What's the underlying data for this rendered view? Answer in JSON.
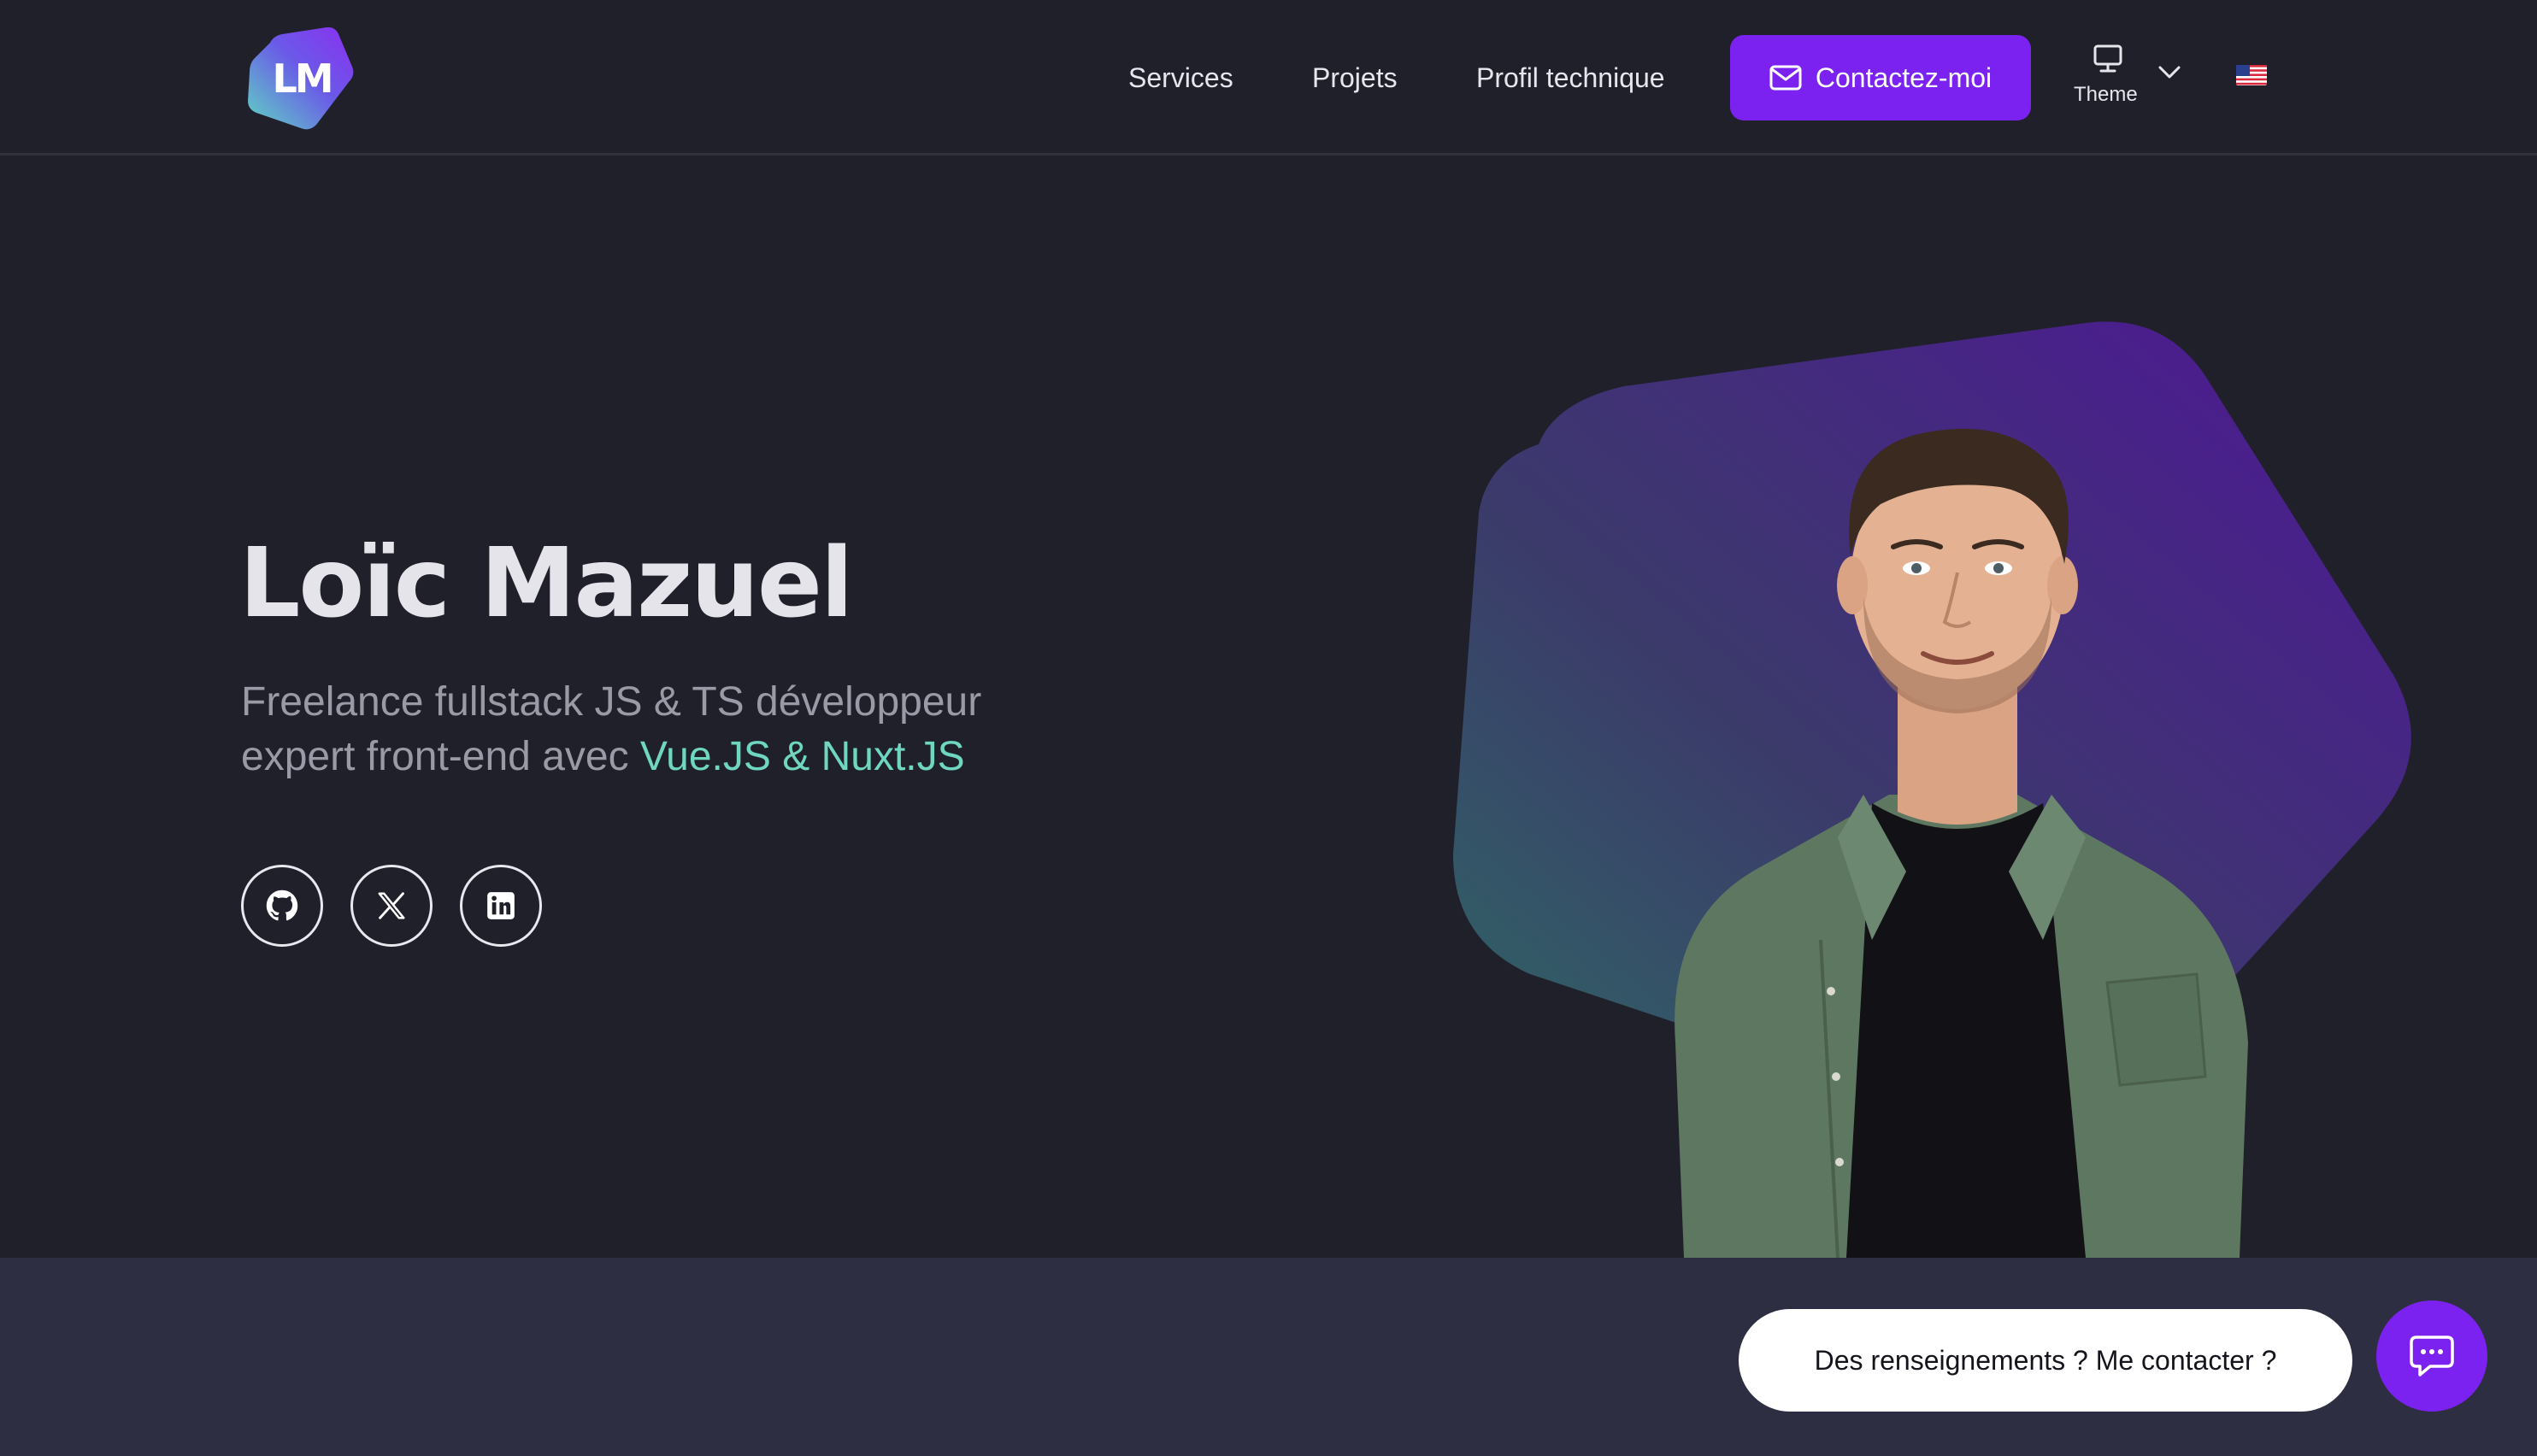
{
  "brand": {
    "logo_text": "LM",
    "gradient_start": "#5fd7c2",
    "gradient_end": "#7b2ff0"
  },
  "nav": {
    "items": [
      {
        "label": "Services"
      },
      {
        "label": "Projets"
      },
      {
        "label": "Profil technique"
      }
    ],
    "cta": {
      "label": "Contactez-moi",
      "icon": "mail-icon",
      "color": "#7c22f0"
    },
    "theme": {
      "label": "Theme",
      "icon": "monitor-icon"
    },
    "language": {
      "icon": "us-flag-icon"
    }
  },
  "hero": {
    "name": "Loïc Mazuel",
    "subtitle_line1": "Freelance fullstack JS & TS développeur",
    "subtitle_line2_prefix": "expert front-end avec ",
    "subtitle_highlight": "Vue.JS & Nuxt.JS",
    "highlight_color": "#6fd6bf",
    "socials": [
      {
        "icon": "github-icon"
      },
      {
        "icon": "x-icon"
      },
      {
        "icon": "linkedin-icon"
      }
    ]
  },
  "chat": {
    "bubble_text": "Des renseignements ? Me contacter ?",
    "icon": "chat-icon"
  }
}
